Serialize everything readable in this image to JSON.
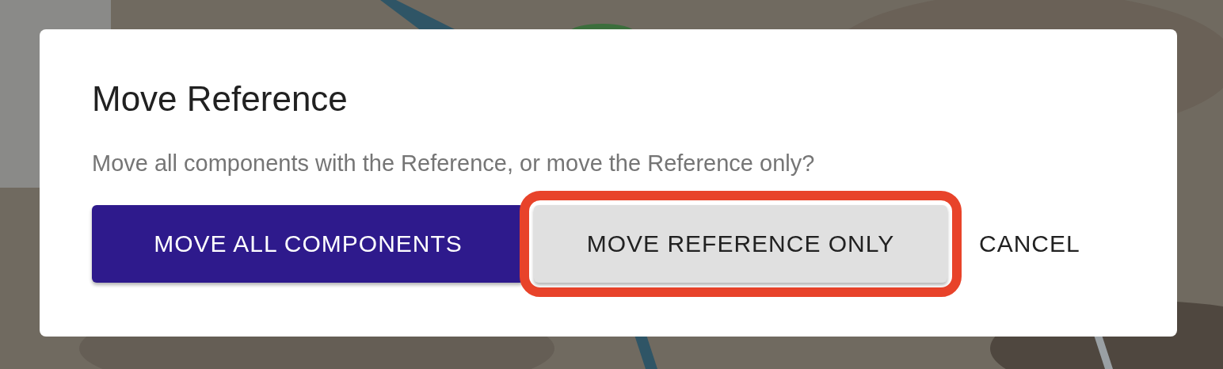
{
  "dialog": {
    "title": "Move Reference",
    "message": "Move all components with the Reference, or move the Reference only?",
    "buttons": [
      {
        "label": "MOVE ALL COMPONENTS",
        "kind": "primary",
        "highlighted": false
      },
      {
        "label": "MOVE REFERENCE ONLY",
        "kind": "secondary",
        "highlighted": true
      },
      {
        "label": "CANCEL",
        "kind": "text",
        "highlighted": false
      }
    ]
  }
}
